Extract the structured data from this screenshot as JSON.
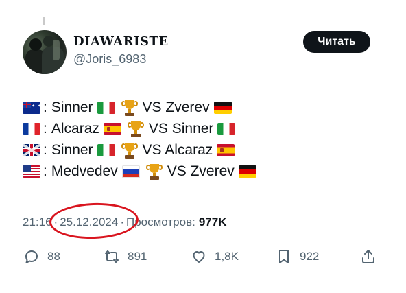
{
  "author": {
    "display_name": "DIAWARISTE",
    "handle": "@Joris_6983"
  },
  "header": {
    "read_label": "Читать"
  },
  "tweet": {
    "lines": [
      {
        "flag": "australia-flag",
        "player1": "Sinner",
        "flag1": "italy-flag",
        "vs": "VS Zverev",
        "flag2": "germany-flag"
      },
      {
        "flag": "france-flag",
        "player1": "Alcaraz",
        "flag1": "spain-flag",
        "vs": "VS Sinner",
        "flag2": "italy-flag"
      },
      {
        "flag": "uk-flag",
        "player1": "Sinner",
        "flag1": "italy-flag",
        "vs": "VS Alcaraz",
        "flag2": "spain-flag"
      },
      {
        "flag": "usa-flag",
        "player1": "Medvedev",
        "flag1": "russia-flag",
        "vs": "VS Zverev",
        "flag2": "germany-flag"
      }
    ],
    "separator": ":",
    "trophy_icon": "trophy-icon"
  },
  "meta": {
    "time": "21:16",
    "dot": "·",
    "date": "25.12.2024",
    "views_label": "Просмотров:",
    "views_count": "977K"
  },
  "actions": {
    "replies": "88",
    "reposts": "891",
    "likes": "1,8K",
    "bookmarks": "922"
  },
  "colors": {
    "highlight": "#d9151f",
    "muted_text": "#536471",
    "primary_text": "#0f1419"
  }
}
